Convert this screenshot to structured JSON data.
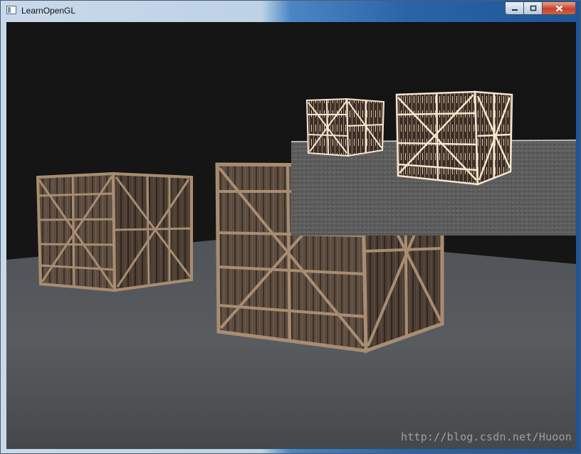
{
  "window": {
    "title": "LearnOpenGL",
    "icons": {
      "app": "window-icon",
      "minimize": "minimize-icon",
      "maximize": "maximize-icon",
      "close": "close-icon"
    }
  },
  "scene": {
    "background_color": "#151515",
    "floor_color": "#55595c",
    "crate_wood_color": "#5a4a3e",
    "crate_frame_color": "#a88d72"
  },
  "postprocess_view": {
    "effect": "edge-detection",
    "edge_color": "#f4e6cf"
  },
  "watermark": {
    "text": "http://blog.csdn.net/Huoon"
  }
}
